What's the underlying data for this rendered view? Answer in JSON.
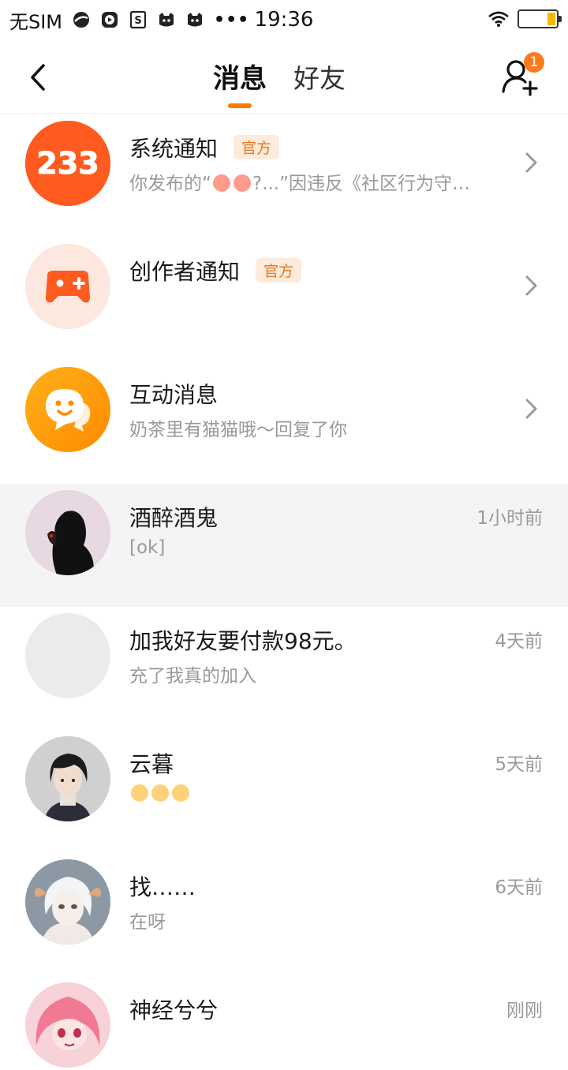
{
  "status_bar": {
    "carrier": "无SIM",
    "dots": "•••",
    "time": "19:36"
  },
  "header": {
    "tabs": [
      {
        "label": "消息",
        "active": true
      },
      {
        "label": "好友",
        "active": false
      }
    ],
    "add_friend_badge": "1"
  },
  "conversations": [
    {
      "name": "系统通知",
      "tag": "官方",
      "preview_prefix": "你发布的“",
      "preview_suffix": "?...”因违反《社区行为守…",
      "time": "",
      "avatar_text": "233"
    },
    {
      "name": "创作者通知",
      "tag": "官方",
      "preview": "",
      "time": ""
    },
    {
      "name": "互动消息",
      "preview": "奶茶里有猫猫哦～回复了你",
      "time": ""
    },
    {
      "name": "酒醉酒鬼",
      "preview": "[ok]",
      "time": "1小时前"
    },
    {
      "name": "加我好友要付款98元。",
      "preview": "充了我真的加入",
      "time": "4天前"
    },
    {
      "name": "云暮",
      "preview": "",
      "time": "5天前"
    },
    {
      "name": "找……",
      "preview": "在呀",
      "time": "6天前"
    },
    {
      "name": "神经兮兮",
      "preview": "",
      "time": "刚刚"
    }
  ],
  "colors": {
    "accent": "#ff7a00",
    "official_tag_bg": "#fdebdc",
    "official_tag_text": "#e6761c",
    "highlight_row": "#f4f4f4"
  }
}
